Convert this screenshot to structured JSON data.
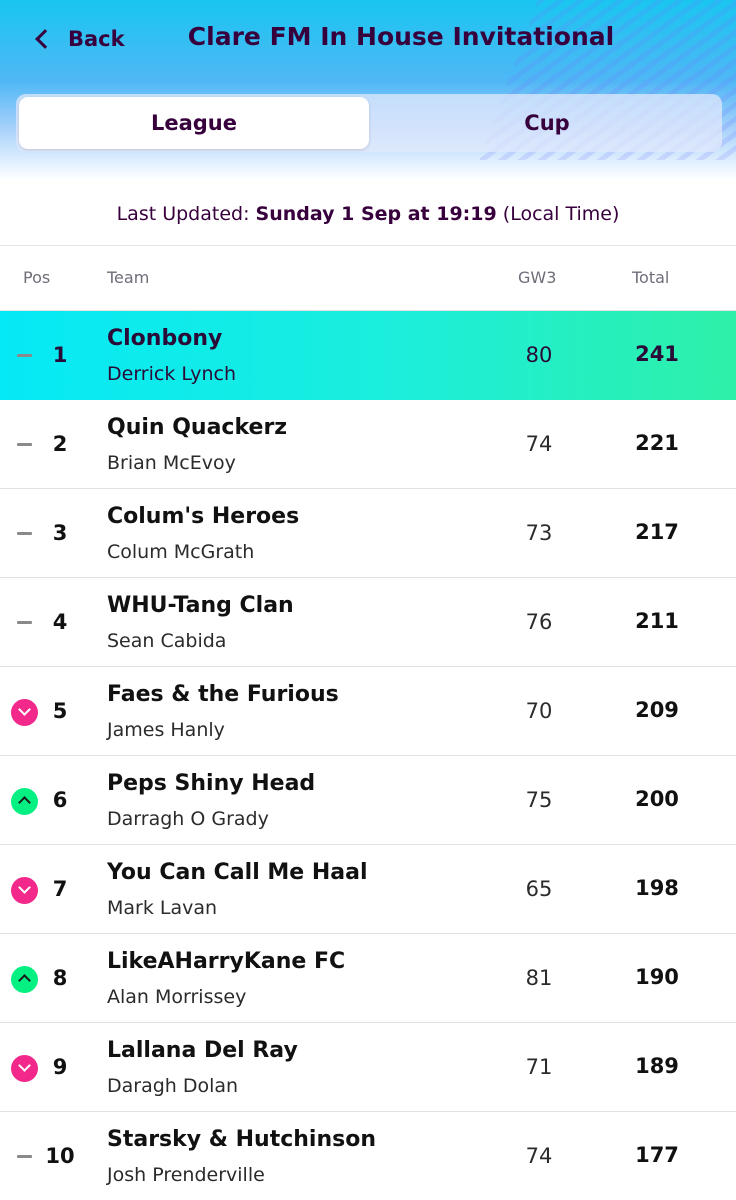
{
  "header": {
    "back_label": "Back",
    "title": "Clare FM In House Invitational",
    "tabs": [
      {
        "label": "League",
        "active": true
      },
      {
        "label": "Cup",
        "active": false
      }
    ]
  },
  "updated": {
    "prefix": "Last Updated:",
    "datetime": "Sunday 1 Sep at 19:19",
    "suffix": "(Local Time)"
  },
  "columns": {
    "pos": "Pos",
    "team": "Team",
    "gw": "GW3",
    "total": "Total"
  },
  "colors": {
    "leader_start": "#05e9f6",
    "leader_end": "#2ef0a8",
    "down": "#f2288a",
    "up": "#05f082",
    "brand": "#37003c"
  },
  "rows": [
    {
      "rank": "1",
      "move": "same",
      "team": "Clonbony",
      "manager": "Derrick Lynch",
      "gw": "80",
      "total": "241"
    },
    {
      "rank": "2",
      "move": "same",
      "team": "Quin Quackerz",
      "manager": "Brian McEvoy",
      "gw": "74",
      "total": "221"
    },
    {
      "rank": "3",
      "move": "same",
      "team": "Colum's Heroes",
      "manager": "Colum McGrath",
      "gw": "73",
      "total": "217"
    },
    {
      "rank": "4",
      "move": "same",
      "team": "WHU-Tang Clan",
      "manager": "Sean Cabida",
      "gw": "76",
      "total": "211"
    },
    {
      "rank": "5",
      "move": "down",
      "team": "Faes & the Furious",
      "manager": "James Hanly",
      "gw": "70",
      "total": "209"
    },
    {
      "rank": "6",
      "move": "up",
      "team": "Peps Shiny Head",
      "manager": "Darragh O Grady",
      "gw": "75",
      "total": "200"
    },
    {
      "rank": "7",
      "move": "down",
      "team": "You Can Call Me Haal",
      "manager": "Mark Lavan",
      "gw": "65",
      "total": "198"
    },
    {
      "rank": "8",
      "move": "up",
      "team": "LikeAHarryKane FC",
      "manager": "Alan Morrissey",
      "gw": "81",
      "total": "190"
    },
    {
      "rank": "9",
      "move": "down",
      "team": "Lallana Del Ray",
      "manager": "Daragh Dolan",
      "gw": "71",
      "total": "189"
    },
    {
      "rank": "10",
      "move": "same",
      "team": "Starsky & Hutchinson",
      "manager": "Josh Prenderville",
      "gw": "74",
      "total": "177"
    }
  ]
}
